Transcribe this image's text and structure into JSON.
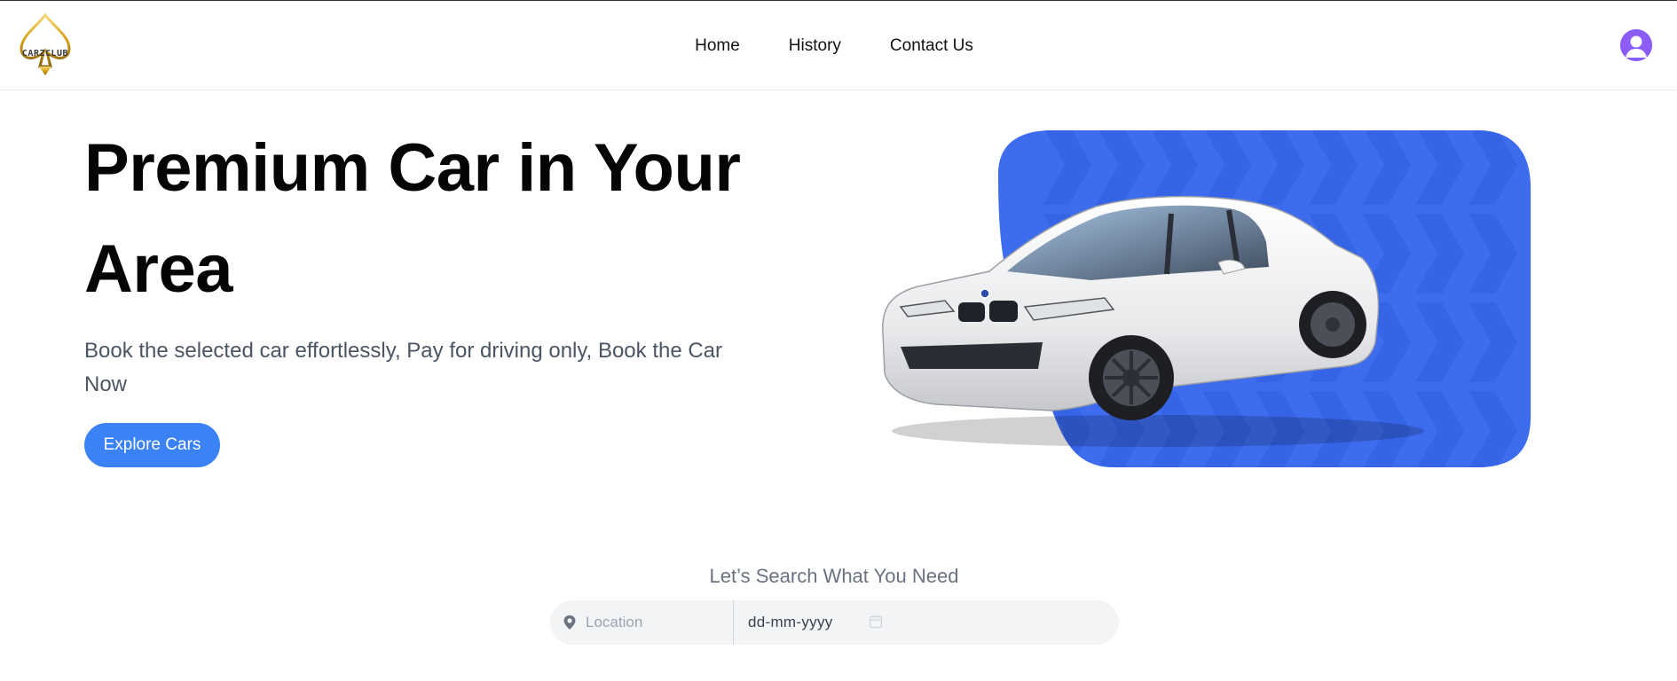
{
  "brand": {
    "logo_text": "CARZCLUB",
    "gold": "#d4a017"
  },
  "nav": {
    "links": [
      {
        "label": "Home"
      },
      {
        "label": "History"
      },
      {
        "label": "Contact Us"
      }
    ],
    "avatar_icon": "user-avatar-icon",
    "avatar_color": "#8b5cf6"
  },
  "hero": {
    "title_line1": "Premium Car in Your",
    "title_line2": "Area",
    "description": "Book the selected car effortlessly, Pay for driving only, Book the Car Now",
    "cta_label": "Explore Cars",
    "accent_color": "#3b82f6",
    "art_blue": "#3e6cee"
  },
  "search": {
    "heading": "Let’s Search What You Need",
    "location_placeholder": "Location",
    "location_icon": "map-pin-icon",
    "date_value": "dd-mm-yyyy",
    "calendar_icon": "calendar-icon"
  }
}
